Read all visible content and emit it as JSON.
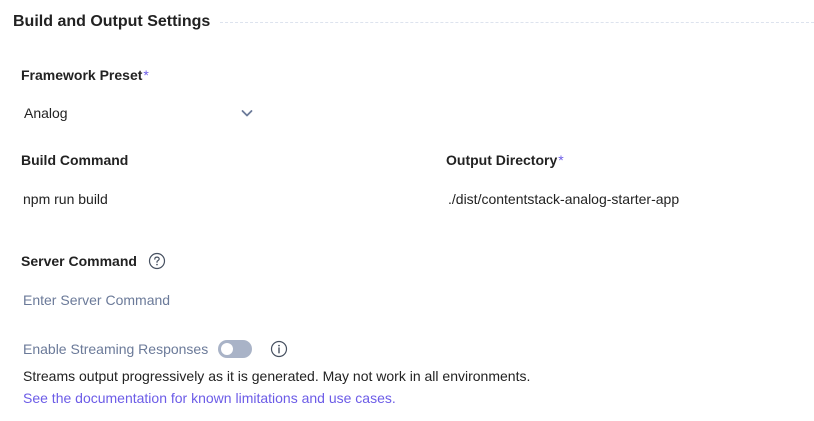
{
  "section": {
    "title": "Build and Output Settings"
  },
  "framework_preset": {
    "label": "Framework Preset",
    "required_mark": "*",
    "selected_value": "Analog",
    "icon": "chevron-down-icon"
  },
  "build_command": {
    "label": "Build Command",
    "value": "npm run build"
  },
  "output_directory": {
    "label": "Output Directory",
    "required_mark": "*",
    "value": "./dist/contentstack-analog-starter-app"
  },
  "server_command": {
    "label": "Server Command",
    "placeholder": "Enter Server Command",
    "help_icon": "question-circle-icon"
  },
  "streaming": {
    "label": "Enable Streaming Responses",
    "enabled": false,
    "info_icon": "info-circle-icon",
    "description": "Streams output progressively as it is generated. May not work in all environments.",
    "doc_link_text": "See the documentation for known limitations and use cases."
  },
  "colors": {
    "accent": "#6c5ce7",
    "muted_text": "#6b7a99",
    "toggle_off": "#a9b3c7"
  }
}
